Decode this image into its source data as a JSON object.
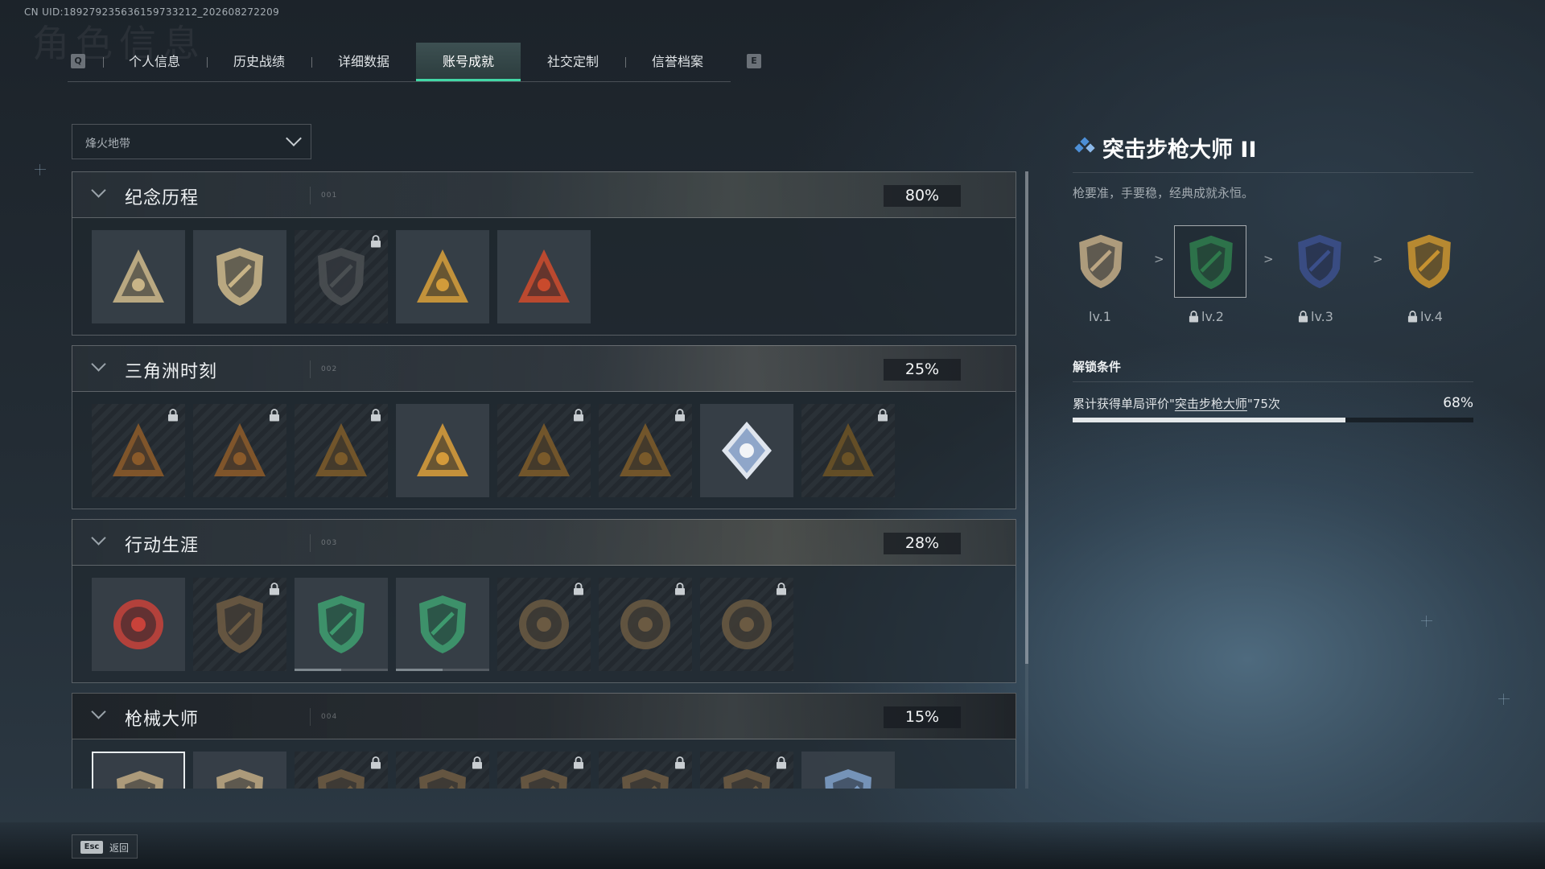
{
  "uid_text": "CN UID:18927923563615973321​2_202608272209",
  "ghost_title": "角色信息",
  "tabs": {
    "left_key": "Q",
    "right_key": "E",
    "items": [
      {
        "label": "个人信息",
        "active": false
      },
      {
        "label": "历史战绩",
        "active": false
      },
      {
        "label": "详细数据",
        "active": false
      },
      {
        "label": "账号成就",
        "active": true
      },
      {
        "label": "社交定制",
        "active": false
      },
      {
        "label": "信誉档案",
        "active": false
      }
    ]
  },
  "mode_select": {
    "value": "烽火地带"
  },
  "groups": [
    {
      "title": "纪念历程",
      "code": "001",
      "percent": "80%",
      "tiles": [
        {
          "icon": "triangle-shield-badge-icon",
          "locked": false,
          "color": "#c8b487"
        },
        {
          "icon": "helicopter-badge-icon",
          "locked": false,
          "color": "#c8b487"
        },
        {
          "icon": "dark-shield-badge-icon",
          "locked": true,
          "color": "#4a4f52"
        },
        {
          "icon": "hands-triangle-badge-icon",
          "locked": false,
          "color": "#d19b3a"
        },
        {
          "icon": "number-one-triangle-badge-icon",
          "locked": false,
          "color": "#c94a2c"
        }
      ]
    },
    {
      "title": "三角洲时刻",
      "code": "002",
      "percent": "25%",
      "tiles": [
        {
          "icon": "bag-triangle-badge-icon",
          "locked": true,
          "color": "#8a5a2a"
        },
        {
          "icon": "soldier-triangle-badge-icon",
          "locked": true,
          "color": "#8a5a2a"
        },
        {
          "icon": "vehicle-triangle-badge-icon",
          "locked": true,
          "color": "#7a5a2a"
        },
        {
          "icon": "squad-triangle-badge-icon",
          "locked": false,
          "color": "#d49a3a"
        },
        {
          "icon": "eagle-triangle-badge-icon",
          "locked": true,
          "color": "#7a5a2a"
        },
        {
          "icon": "rescue-triangle-badge-icon",
          "locked": true,
          "color": "#7a5a2a"
        },
        {
          "icon": "rose-diamond-badge-icon",
          "locked": false,
          "color": "#8fa6c9"
        },
        {
          "icon": "dragon-triangle-badge-icon",
          "locked": true,
          "color": "#6a5226"
        }
      ]
    },
    {
      "title": "行动生涯",
      "code": "003",
      "percent": "28%",
      "tiles": [
        {
          "icon": "star-emblem-badge-icon",
          "locked": false,
          "color": "#c9423a"
        },
        {
          "icon": "bronze-shield-badge-icon",
          "locked": true,
          "color": "#6b5a42"
        },
        {
          "icon": "green-shield-badge-icon",
          "locked": false,
          "color": "#3e9a6e",
          "progress": 0.5
        },
        {
          "icon": "green-emblem-badge-icon",
          "locked": false,
          "color": "#3e9a6e",
          "progress": 0.5
        },
        {
          "icon": "round-helmet-badge-icon",
          "locked": true,
          "color": "#6b5a42"
        },
        {
          "icon": "round-crosshair-badge-icon",
          "locked": true,
          "color": "#6b5a42"
        },
        {
          "icon": "round-eye-badge-icon",
          "locked": true,
          "color": "#6b5a42"
        }
      ]
    },
    {
      "title": "枪械大师",
      "code": "004",
      "percent": "15%",
      "tiles": [
        {
          "icon": "rifle-shield-badge-icon",
          "locked": false,
          "selected": true,
          "color": "#b9a47f"
        },
        {
          "icon": "smg-shield-badge-icon",
          "locked": false,
          "color": "#b9a47f"
        },
        {
          "icon": "shotgun-shield-badge-icon",
          "locked": true,
          "color": "#6b5a42"
        },
        {
          "icon": "lmg-shield-badge-icon",
          "locked": true,
          "color": "#6b5a42"
        },
        {
          "icon": "marksman-shield-badge-icon",
          "locked": true,
          "color": "#6b5a42"
        },
        {
          "icon": "sniper-shield-badge-icon",
          "locked": true,
          "color": "#6b5a42"
        },
        {
          "icon": "pistol-shield-badge-icon",
          "locked": true,
          "color": "#6b5a42"
        },
        {
          "icon": "blue-crosshair-badge-icon",
          "locked": false,
          "color": "#7c9cc4"
        }
      ]
    }
  ],
  "detail": {
    "title": "突击步枪大师 II",
    "description": "枪要准，手要稳，经典成就永恒。",
    "levels": [
      {
        "label": "lv.1",
        "locked": false,
        "selected": false,
        "color": "#bca683"
      },
      {
        "label": "lv.2",
        "locked": true,
        "selected": true,
        "color": "#2f7a4c"
      },
      {
        "label": "lv.3",
        "locked": true,
        "selected": false,
        "color": "#3b4f8a"
      },
      {
        "label": "lv.4",
        "locked": true,
        "selected": false,
        "color": "#c79230"
      }
    ],
    "level_separator": ">",
    "unlock": {
      "title": "解锁条件",
      "prefix": "累计获得单局评价\"",
      "link": "突击步枪大师",
      "suffix": "\"75次",
      "percent_text": "68%",
      "progress": 0.68
    }
  },
  "footer": {
    "esc_key": "Esc",
    "back_label": "返回"
  },
  "colors": {
    "accent": "#42d8a6",
    "title_icon": "#4d8fd6"
  }
}
